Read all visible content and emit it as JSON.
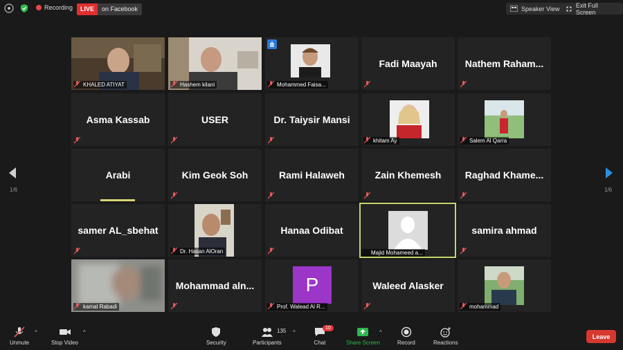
{
  "topbar": {
    "recording_label": "Recording",
    "live_badge": "LIVE",
    "live_target": "on Facebook",
    "speaker_view_label": "Speaker View",
    "exit_full_screen_label": "Exit Full Screen"
  },
  "gallery": {
    "page_indicator_left": "1/6",
    "page_indicator_right": "1/6",
    "tiles": [
      {
        "kind": "video",
        "label": "KHALED ATIYAT"
      },
      {
        "kind": "video",
        "label": "Hashem kilani"
      },
      {
        "kind": "video",
        "label": "Mohammed Faisa..."
      },
      {
        "kind": "name",
        "name": "Fadi Maayah"
      },
      {
        "kind": "name",
        "name": "Nathem  Raham..."
      },
      {
        "kind": "name",
        "name": "Asma Kassab"
      },
      {
        "kind": "name",
        "name": "USER"
      },
      {
        "kind": "name",
        "name": "Dr. Taiysir Mansi"
      },
      {
        "kind": "video",
        "label": "khitam Ay"
      },
      {
        "kind": "video",
        "label": "Salem Al Qarra"
      },
      {
        "kind": "name",
        "name": "Arabi"
      },
      {
        "kind": "name",
        "name": "Kim Geok Soh"
      },
      {
        "kind": "name",
        "name": "Rami Halaweh"
      },
      {
        "kind": "name",
        "name": "Zain Khemesh"
      },
      {
        "kind": "name",
        "name": "Raghad  Khame..."
      },
      {
        "kind": "name",
        "name": "samer AL_sbehat"
      },
      {
        "kind": "video",
        "label": "Dr. Hasan AlOran"
      },
      {
        "kind": "name",
        "name": "Hanaa Odibat"
      },
      {
        "kind": "video",
        "label": "Majid Mohameed a..."
      },
      {
        "kind": "name",
        "name": "samira ahmad"
      },
      {
        "kind": "video",
        "label": "kamal Rabadi"
      },
      {
        "kind": "name",
        "name": "Mohammad  aln..."
      },
      {
        "kind": "video",
        "label": "Prof. Walead Al R...",
        "initial": "P"
      },
      {
        "kind": "name",
        "name": "Waleed Alasker"
      },
      {
        "kind": "video",
        "label": "mohammad"
      }
    ]
  },
  "toolbar": {
    "unmute": "Unmute",
    "stop_video": "Stop Video",
    "security": "Security",
    "participants": "Participants",
    "participants_count": "135",
    "chat": "Chat",
    "chat_badge": "10",
    "share_screen": "Share Screen",
    "record": "Record",
    "reactions": "Reactions",
    "leave": "Leave"
  },
  "colors": {
    "share_green": "#2fb84e",
    "leave_red": "#d6382f",
    "live_red": "#e02f2f",
    "active_speaker": "#c8d46e",
    "nav_arrow": "#2b8fe0"
  }
}
